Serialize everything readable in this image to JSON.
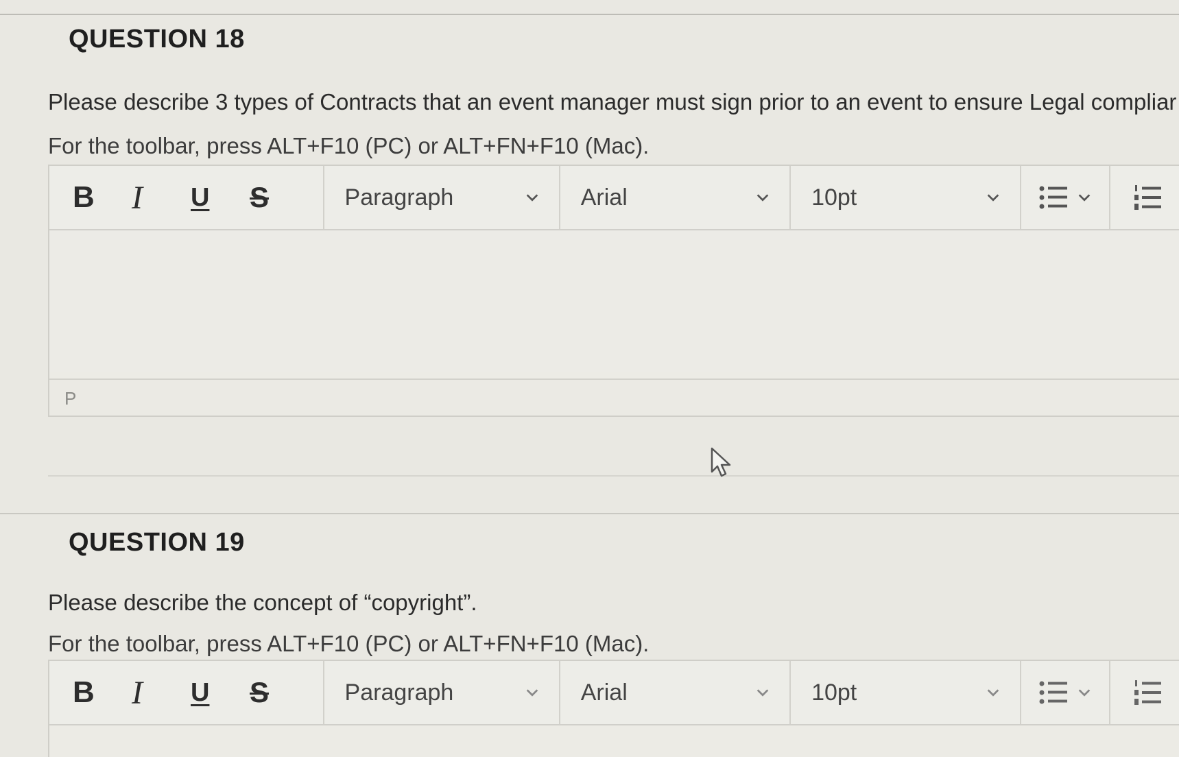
{
  "q18": {
    "title": "QUESTION 18",
    "prompt": "Please describe 3 types of Contracts that an event manager must sign prior to an event to ensure Legal compliar",
    "hint": "For the toolbar, press ALT+F10 (PC) or ALT+FN+F10 (Mac).",
    "toolbar": {
      "bold": "B",
      "italic": "I",
      "underline": "U",
      "strike": "S",
      "paragraph": "Paragraph",
      "font": "Arial",
      "size": "10pt"
    },
    "status_path": "P"
  },
  "q19": {
    "title": "QUESTION 19",
    "prompt": "Please describe the concept of “copyright”.",
    "hint": "For the toolbar, press ALT+F10 (PC) or ALT+FN+F10 (Mac).",
    "toolbar": {
      "bold": "B",
      "italic": "I",
      "underline": "U",
      "strike": "S",
      "paragraph": "Paragraph",
      "font": "Arial",
      "size": "10pt"
    }
  },
  "icons": {
    "bullet_list": "bullet-list-icon",
    "numbered_list": "numbered-list-icon",
    "chevron": "chevron-down-icon",
    "cursor": "mouse-pointer-icon"
  }
}
